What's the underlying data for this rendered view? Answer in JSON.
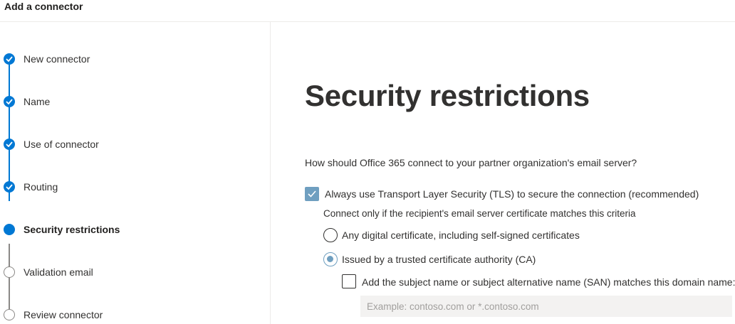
{
  "header": {
    "title": "Add a connector"
  },
  "steps": [
    {
      "label": "New connector",
      "state": "done"
    },
    {
      "label": "Name",
      "state": "done"
    },
    {
      "label": "Use of connector",
      "state": "done"
    },
    {
      "label": "Routing",
      "state": "done"
    },
    {
      "label": "Security restrictions",
      "state": "current"
    },
    {
      "label": "Validation email",
      "state": "todo"
    },
    {
      "label": "Review connector",
      "state": "todo"
    }
  ],
  "main": {
    "title": "Security restrictions",
    "question": "How should Office 365 connect to your partner organization's email server?",
    "tls": {
      "label": "Always use Transport Layer Security (TLS) to secure the connection (recommended)",
      "checked": true
    },
    "criteria": "Connect only if the recipient's email server certificate matches this criteria",
    "options": [
      {
        "label": "Any digital certificate, including self-signed certificates",
        "selected": false
      },
      {
        "label": "Issued by a trusted certificate authority (CA)",
        "selected": true
      }
    ],
    "san": {
      "label": "Add the subject name or subject alternative name (SAN) matches this domain name:",
      "checked": false,
      "placeholder": "Example: contoso.com or *.contoso.com",
      "value": ""
    }
  },
  "colors": {
    "accent": "#0078d4",
    "checkbox_fill": "#6f9fc0",
    "input_bg": "#f3f2f1"
  }
}
